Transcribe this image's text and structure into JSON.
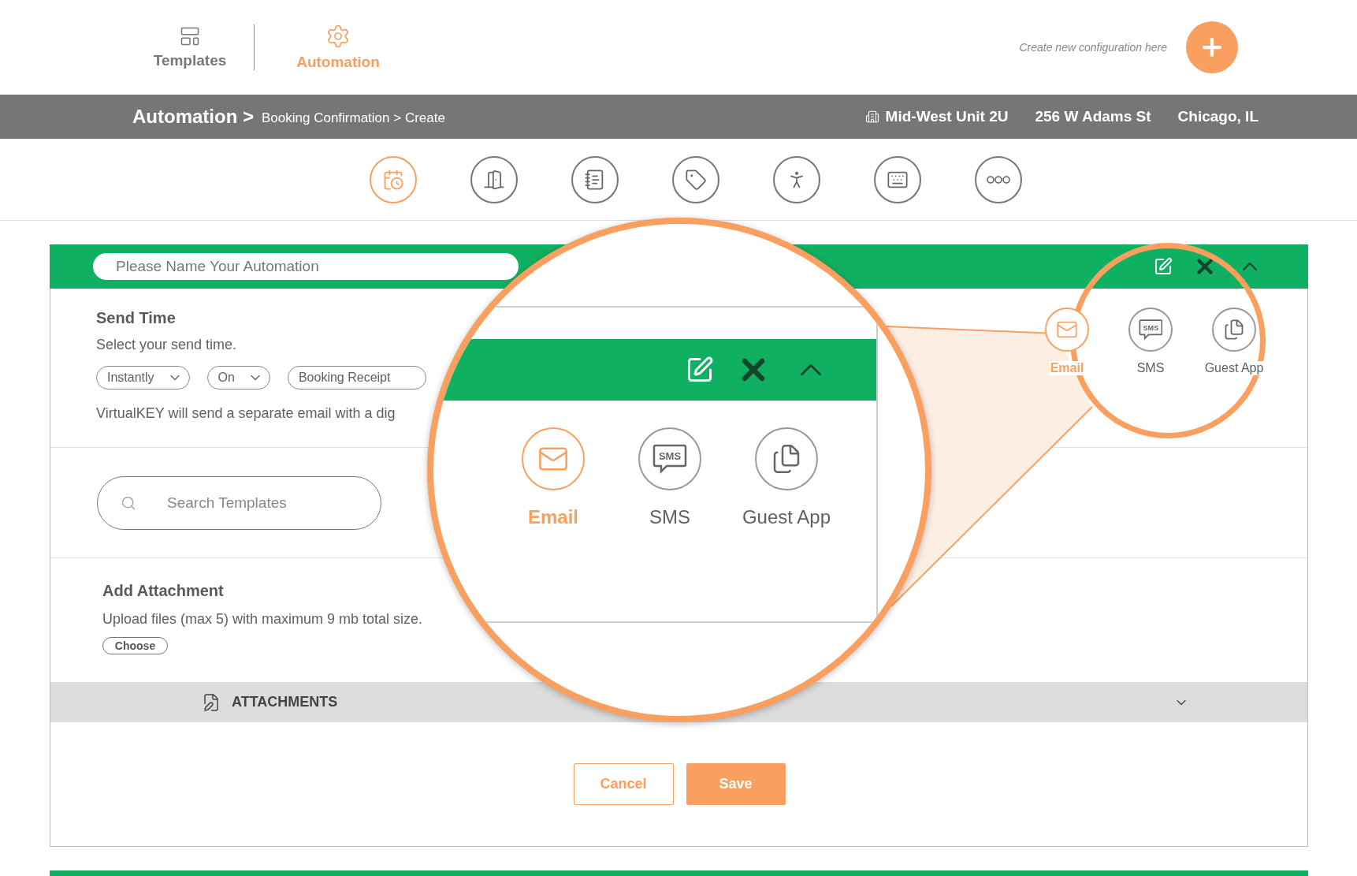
{
  "top_nav": {
    "tabs": [
      {
        "label": "Templates",
        "kind": "templates",
        "selected": false
      },
      {
        "label": "Automation",
        "kind": "automation",
        "selected": true
      }
    ],
    "hint": "Create new configuration here"
  },
  "breadcrumb": {
    "root": "Automation >",
    "path": "Booking Confirmation > Create"
  },
  "location": {
    "unit": "Mid-West Unit 2U",
    "street": "256 W Adams St",
    "city": "Chicago, IL"
  },
  "steps": [
    {
      "kind": "calendar",
      "selected": true
    },
    {
      "kind": "checkin",
      "selected": false
    },
    {
      "kind": "book",
      "selected": false
    },
    {
      "kind": "tag",
      "selected": false
    },
    {
      "kind": "checkout",
      "selected": false
    },
    {
      "kind": "keypad",
      "selected": false
    },
    {
      "kind": "more",
      "selected": false
    }
  ],
  "automation": {
    "name_placeholder": "Please Name Your Automation",
    "channels": [
      {
        "label": "Email",
        "kind": "email",
        "selected": true
      },
      {
        "label": "SMS",
        "kind": "sms",
        "icon_text": "SMS",
        "selected": false
      },
      {
        "label": "Guest App",
        "kind": "app",
        "selected": false
      }
    ],
    "send_time": {
      "title": "Send Time",
      "subtitle": "Select your send time.",
      "selects": [
        {
          "value": "Instantly",
          "caret": true
        },
        {
          "value": "On",
          "caret": true
        },
        {
          "value": "Booking Receipt",
          "caret": false
        }
      ],
      "note": "VirtualKEY will send a separate email with a dig"
    },
    "search": {
      "placeholder": "Search Templates"
    },
    "attachment": {
      "title": "Add Attachment",
      "note": "Upload files (max 5) with maximum 9 mb total size.",
      "choose": "Choose"
    },
    "attachments_bar": {
      "label": "ATTACHMENTS",
      "expanded": false
    },
    "buttons": {
      "cancel": "Cancel",
      "save": "Save"
    }
  },
  "magnifier": {
    "channels": [
      {
        "label": "Email",
        "kind": "email",
        "selected": true
      },
      {
        "label": "SMS",
        "kind": "sms",
        "icon_text": "SMS",
        "selected": false
      },
      {
        "label": "Guest App",
        "kind": "app",
        "selected": false
      }
    ]
  }
}
